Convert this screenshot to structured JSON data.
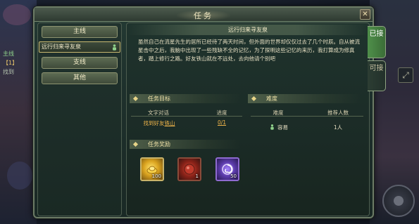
{
  "window": {
    "title": "任务",
    "close_label": "✕"
  },
  "background": {
    "hud_lines": [
      "主线",
      "【1】",
      "找到"
    ]
  },
  "left_panel": {
    "categories": {
      "main": "主线",
      "side": "支线",
      "other": "其他"
    },
    "selected_quest": "远行归来寻友泉"
  },
  "quest": {
    "title": "远行归来寻友泉",
    "description": "虽然自己在流星先生的居所已经待了两天时间，但外面的世界却仅仅过去了几个时辰。自从被流星击中之后，我脑中出现了一些残缺不全的记忆，为了探明这些记忆的来历，我打算成为修真者，踏上修行之路。好友铁山就在不远处，去向他请个别吧",
    "objective": {
      "header": "任务目标",
      "col_text": "文字对话",
      "col_progress": "进度",
      "rows": [
        {
          "prefix": "找到好友",
          "target": "铁山",
          "progress": "0/1"
        }
      ]
    },
    "difficulty": {
      "header": "难度",
      "col_level": "难度",
      "col_players": "推荐人数",
      "level": "容易",
      "players": "1人"
    },
    "rewards": {
      "header": "任务奖励",
      "items": [
        {
          "icon": "gold-ingot-icon",
          "count": "100"
        },
        {
          "icon": "red-orb-icon",
          "count": "1"
        },
        {
          "icon": "purple-swirl-icon",
          "count": "50"
        }
      ]
    }
  },
  "side_tabs": {
    "active": "已接",
    "inactive": "可接"
  },
  "colors": {
    "accent_gold": "#f0b54a",
    "active_tab": "#4f8f4a",
    "panel_bg": "#1f332d"
  }
}
